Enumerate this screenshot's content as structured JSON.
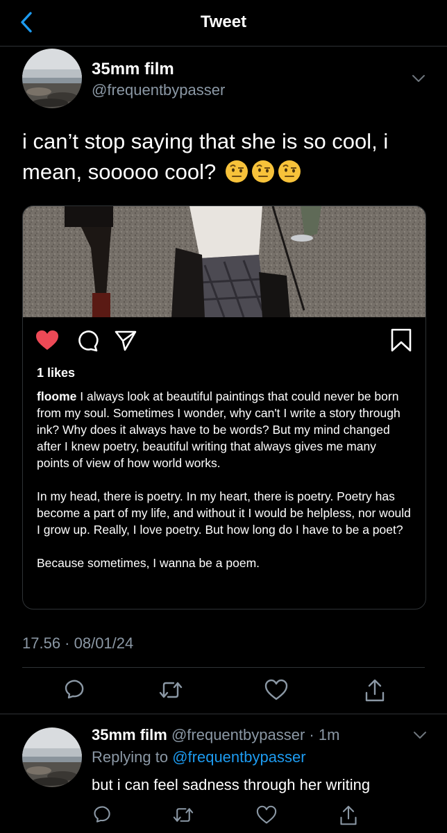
{
  "nav": {
    "title": "Tweet"
  },
  "tweet": {
    "author_name": "35mm film",
    "author_handle": "@frequentbypasser",
    "text": "i can’t stop saying that she is so cool, i mean, sooooo cool?",
    "emojis": [
      "face-with-raised-eyebrow",
      "face-with-raised-eyebrow",
      "face-with-raised-eyebrow"
    ],
    "timestamp": "17.56 · 08/01/24"
  },
  "embed": {
    "likes": "1 likes",
    "username": "floome",
    "caption_p1": "I always look at beautiful paintings that could never be born from my soul. Sometimes I wonder, why can't I write a story through ink? Why does it always have to be words? But my mind changed after I knew poetry, beautiful writing that always gives me many points of view of how world works.",
    "caption_p2": "In my head, there is poetry. In my heart, there is poetry. Poetry has become a part of my life, and without it I would be helpless, nor would I grow up. Really, I love poetry. But how long do I have to be a poet?",
    "caption_p3": "Because sometimes, I wanna be a poem.",
    "icons": [
      "heart-filled-icon",
      "comment-icon",
      "send-icon",
      "bookmark-icon"
    ],
    "heart_color": "#ed4956"
  },
  "reply": {
    "author_name": "35mm film",
    "author_handle": "@frequentbypasser",
    "separator": "·",
    "time": "1m",
    "replying_label": "Replying to",
    "replying_handle": "@frequentbypasser",
    "text": "but i can feel sadness through her writing"
  },
  "colors": {
    "accent": "#1d9bf0",
    "secondary_text": "#8b98a5",
    "divider": "#2f3336"
  }
}
